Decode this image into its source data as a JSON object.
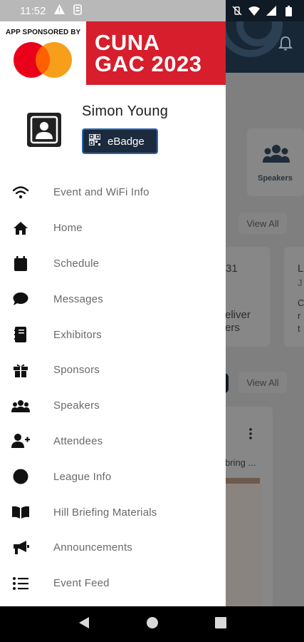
{
  "status_bar": {
    "time": "11:52"
  },
  "banner": {
    "sponsor_label": "APP SPONSORED BY",
    "event_line1": "CUNA",
    "event_line2": "GAC 2023",
    "brand_red": "#d61e2c"
  },
  "profile": {
    "name": "Simon Young",
    "badge_label": "eBadge"
  },
  "menu": {
    "items": [
      {
        "label": "Event and WiFi Info",
        "icon": "wifi-icon"
      },
      {
        "label": "Home",
        "icon": "home-icon"
      },
      {
        "label": "Schedule",
        "icon": "calendar-icon"
      },
      {
        "label": "Messages",
        "icon": "chat-icon"
      },
      {
        "label": "Exhibitors",
        "icon": "address-book-icon"
      },
      {
        "label": "Sponsors",
        "icon": "gift-icon"
      },
      {
        "label": "Speakers",
        "icon": "users-icon"
      },
      {
        "label": "Attendees",
        "icon": "user-plus-icon"
      },
      {
        "label": "League Info",
        "icon": "circle-icon"
      },
      {
        "label": "Hill Briefing Materials",
        "icon": "book-open-icon"
      },
      {
        "label": "Announcements",
        "icon": "megaphone-icon"
      },
      {
        "label": "Event Feed",
        "icon": "list-icon"
      }
    ]
  },
  "background": {
    "speakers_label": "Speakers",
    "view_all_1": "View All",
    "view_all_2": "View All",
    "frag_31": "31",
    "frag_l": "L",
    "frag_j": "J",
    "frag_eliver": "eliver",
    "frag_ers": "ers",
    "frag_c": "C",
    "frag_r": "r",
    "frag_t": "t",
    "frag_bring": "bring ..."
  }
}
